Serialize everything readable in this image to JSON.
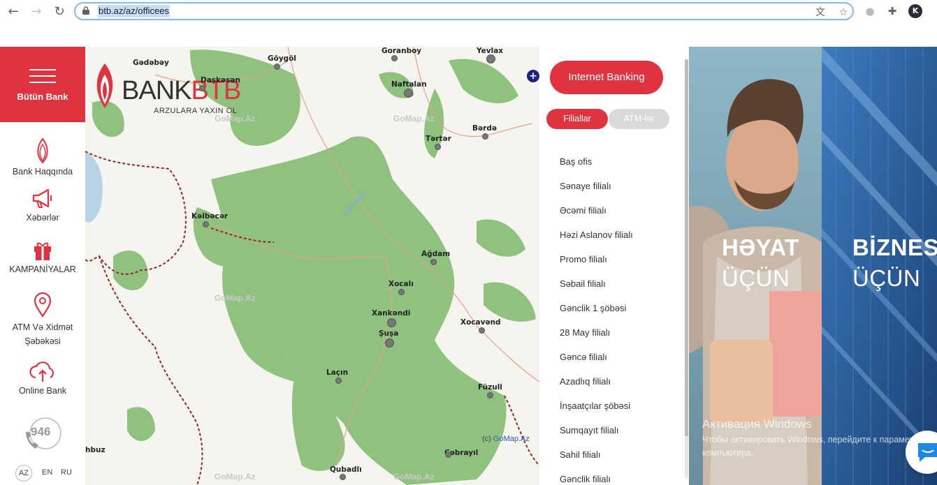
{
  "browser": {
    "url": "btb.az/az/officees",
    "nav_icons": [
      "back-icon",
      "forward-icon",
      "reload-icon"
    ],
    "profile_initial": "K"
  },
  "sidebar": {
    "all_bank_label": "Bütün Bank",
    "items": [
      {
        "label": "Bank Haqqında",
        "icon": "flame-icon"
      },
      {
        "label": "Xəbərlər",
        "icon": "megaphone-icon"
      },
      {
        "label": "KAMPANİYALAR",
        "icon": "gift-icon"
      },
      {
        "label": "ATM Və Xidmət Şəbəkəsi",
        "icon": "location-pin-icon"
      },
      {
        "label": "Online Bank",
        "icon": "cloud-upload-icon"
      }
    ],
    "hotline": "946",
    "languages": [
      "AZ",
      "EN",
      "RU"
    ],
    "active_language": "AZ"
  },
  "logo": {
    "word_bank": "BANK",
    "word_btb": "BTB",
    "tagline": "ARZULARA YAXIN OL"
  },
  "map": {
    "cities": [
      "Gədəbəy",
      "Daşkəsən",
      "Göygöl",
      "Goranboy",
      "Yevlax",
      "Naftalan",
      "Bərdə",
      "Tərtər",
      "Kəlbəcər",
      "Ağdam",
      "Xocalı",
      "Xankəndi",
      "Xocavənd",
      "Şuşa",
      "Laçın",
      "Füzuli",
      "Cəbrayıl",
      "Qubadlı",
      "hbuz"
    ],
    "watermark": "GoMap.Az",
    "copyright_prefix": "(c) ",
    "copyright_link": "GoMap.Az",
    "zoom_label": "+"
  },
  "panel": {
    "internet_banking_label": "Internet Banking",
    "tabs": {
      "branches": "Filiallar",
      "atms": "ATM-lər"
    },
    "branches": [
      "Baş ofis",
      "Sənaye filialı",
      "Əcəmi filialı",
      "Həzi Aslanov filialı",
      "Promo filialı",
      "Səbail filialı",
      "Gənclik 1 şöbəsi",
      "28 May filialı",
      "Gəncə filialı",
      "Azadlıq filialı",
      "İnşaatçılar şöbəsi",
      "Sumqayıt filialı",
      "Sahil filialı",
      "Gənclik filialı"
    ]
  },
  "banners": [
    {
      "line1": "HƏYAT",
      "line2": "ÜÇÜN"
    },
    {
      "line1": "BİZNES",
      "line2": "ÜÇÜN"
    }
  ],
  "windows_activation": {
    "title": "Активация Windows",
    "text": "Чтобы активировать Windows, перейдите к параметрам компьютера."
  },
  "colors": {
    "brand_red": "#e1323f",
    "map_forest": "#8fc27f"
  }
}
